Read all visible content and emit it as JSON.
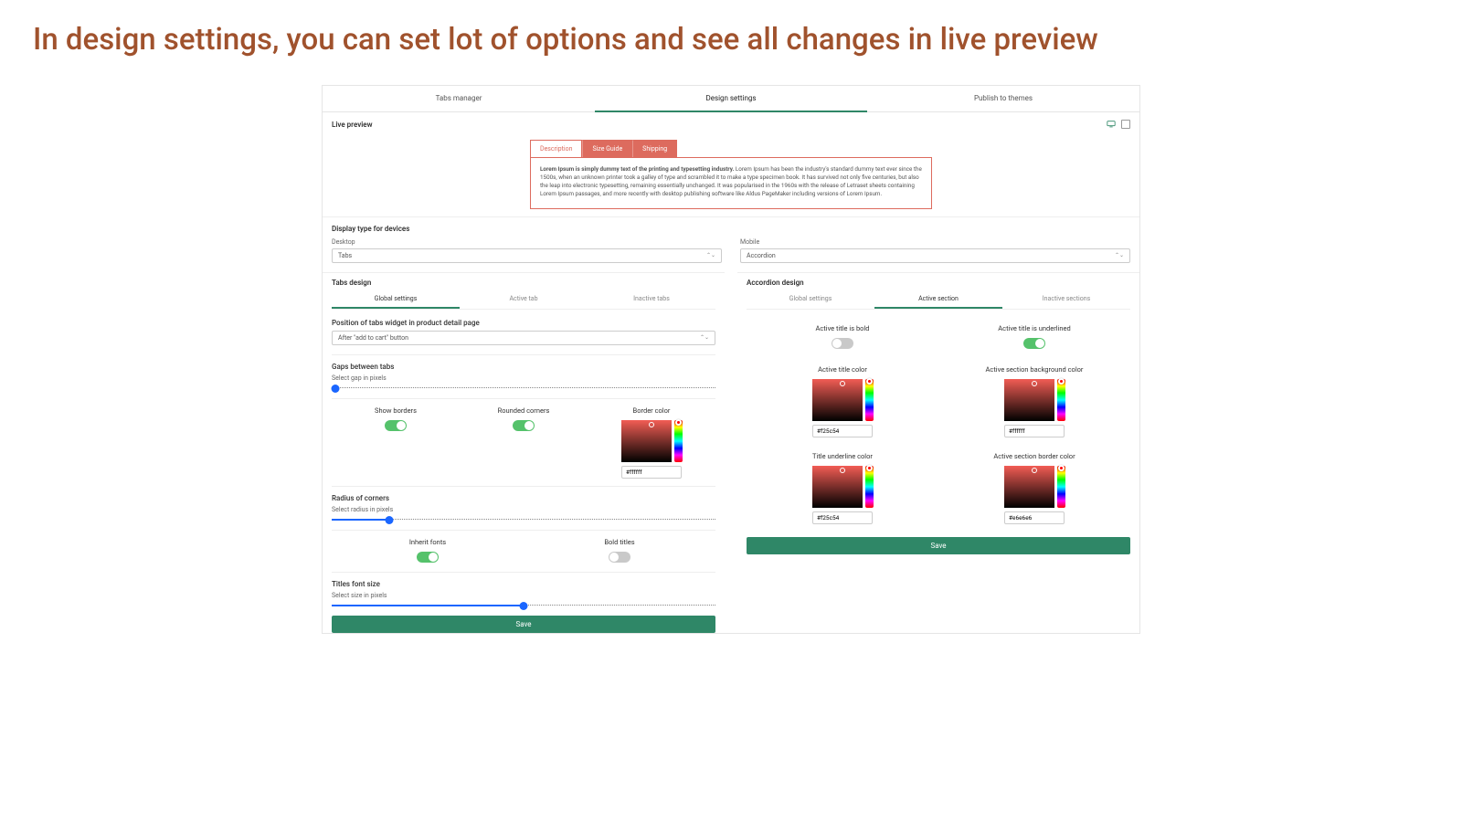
{
  "headline": "In design settings, you can set lot of options and see all changes in live preview",
  "topTabs": {
    "manager": "Tabs manager",
    "design": "Design settings",
    "publish": "Publish to themes"
  },
  "preview": {
    "title": "Live preview",
    "tabs": {
      "desc": "Description",
      "size": "Size Guide",
      "ship": "Shipping"
    },
    "bold": "Lorem Ipsum is simply dummy text of the printing and typesetting industry.",
    "body": " Lorem Ipsum has been the industry's standard dummy text ever since the 1500s, when an unknown printer took a galley of type and scrambled it to make a type specimen book. It has survived not only five centuries, but also the leap into electronic typesetting, remaining essentially unchanged. It was popularised in the 1960s with the release of Letraset sheets containing Lorem Ipsum passages, and more recently with desktop publishing software like Aldus PageMaker including versions of Lorem Ipsum."
  },
  "displayType": {
    "title": "Display type for devices",
    "desktopLabel": "Desktop",
    "desktopValue": "Tabs",
    "mobileLabel": "Mobile",
    "mobileValue": "Accordion"
  },
  "tabsDesign": {
    "title": "Tabs design",
    "subtabs": {
      "global": "Global settings",
      "active": "Active tab",
      "inactive": "Inactive tabs"
    },
    "positionLabel": "Position of tabs widget in product detail page",
    "positionValue": "After \"add to cart\" button",
    "gaps": {
      "title": "Gaps between tabs",
      "sub": "Select gap in pixels"
    },
    "opts": {
      "showBorders": "Show borders",
      "rounded": "Rounded corners",
      "borderColor": "Border color",
      "borderHex": "#ffffff"
    },
    "radius": {
      "title": "Radius of corners",
      "sub": "Select radius in pixels"
    },
    "fonts": {
      "inherit": "Inherit fonts",
      "bold": "Bold titles"
    },
    "titlesFont": {
      "title": "Titles font size",
      "sub": "Select size in pixels"
    },
    "save": "Save"
  },
  "accordion": {
    "title": "Accordion design",
    "subtabs": {
      "global": "Global settings",
      "active": "Active section",
      "inactive": "Inactive sections"
    },
    "cells": {
      "bold": "Active title is bold",
      "underlined": "Active title is underlined",
      "titleColor": "Active title color",
      "titleHex": "#f25c54",
      "bgColor": "Active section background color",
      "bgHex": "#ffffff",
      "underlineColor": "Title underline color",
      "underlineHex": "#f25c54",
      "borderColor": "Active section border color",
      "borderHex": "#e6e6e6"
    },
    "save": "Save"
  }
}
